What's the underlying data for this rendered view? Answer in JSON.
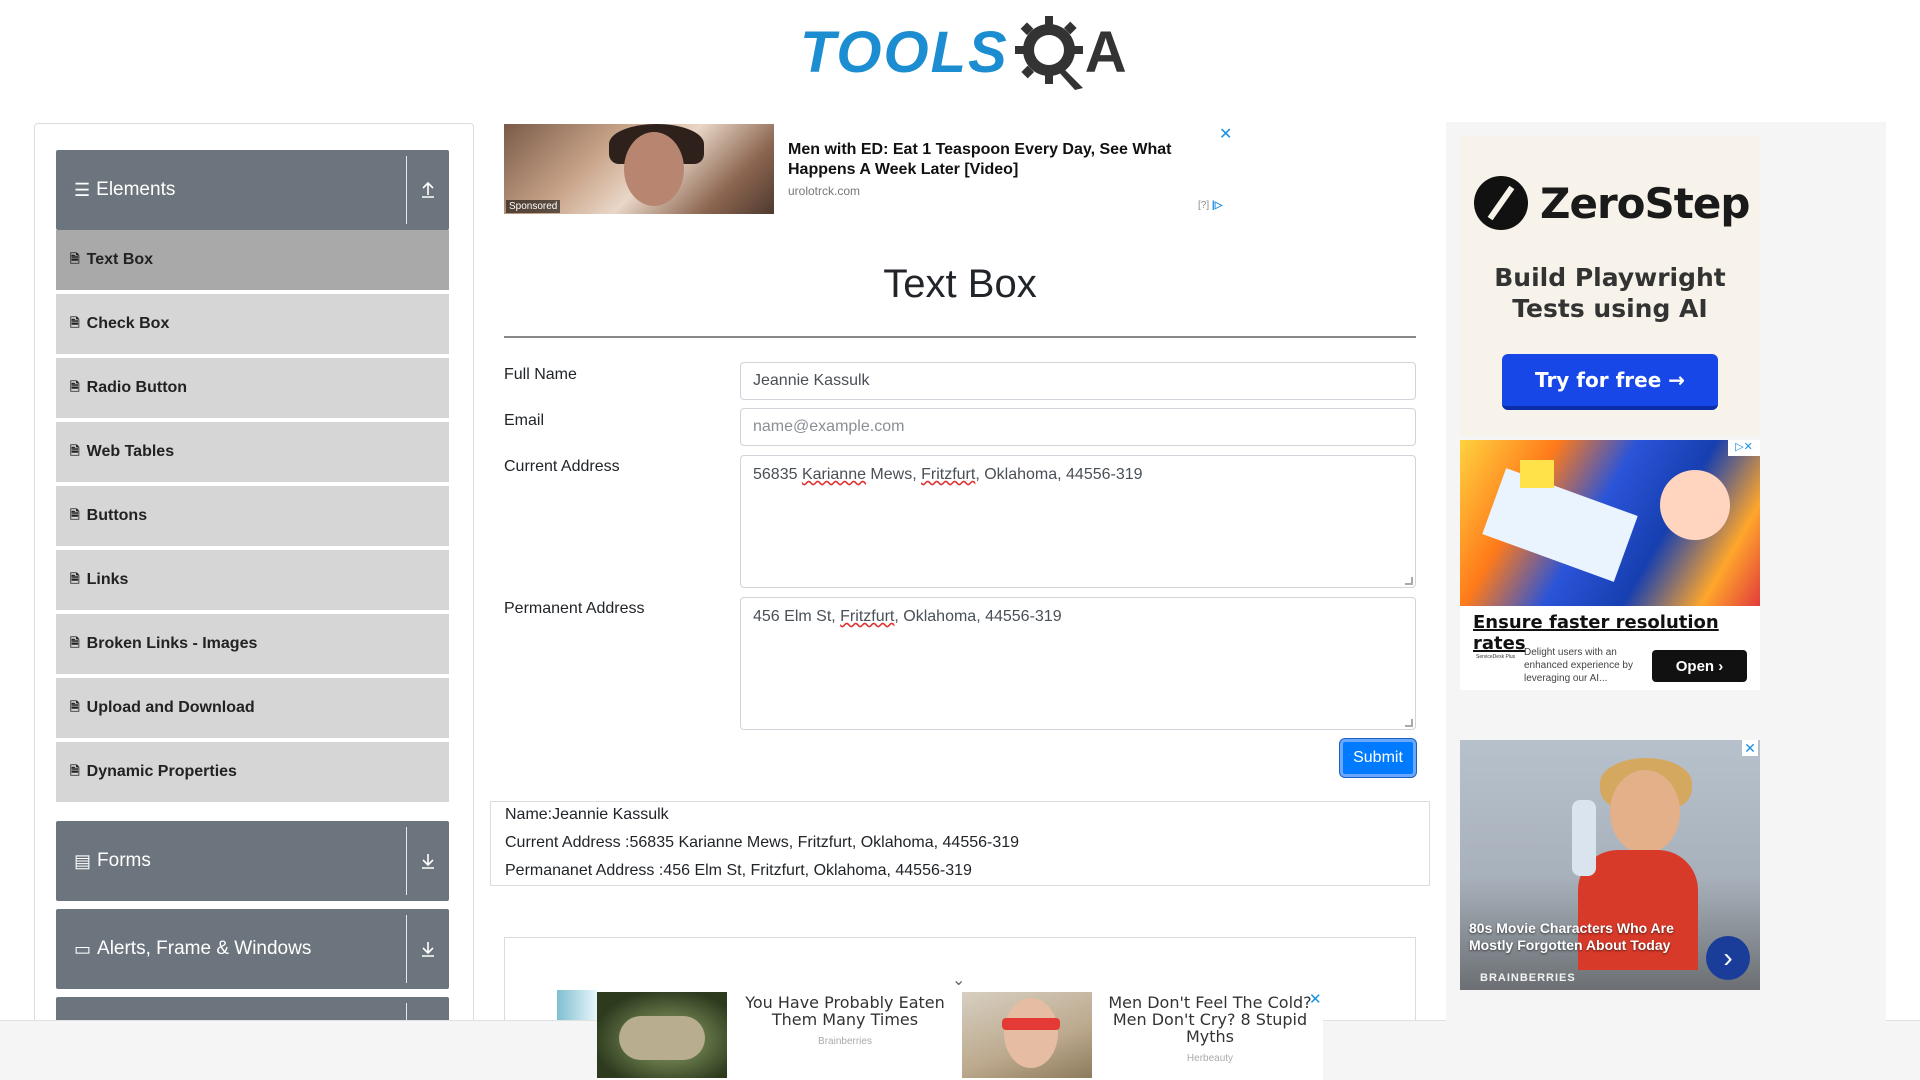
{
  "header": {
    "logo_text_left": "TOOLS",
    "logo_text_right": "A",
    "logo_icon": "gear-q-icon",
    "brand_color": "#1b8dd0"
  },
  "sidebar": {
    "groups": [
      {
        "label": "Elements",
        "icon": "hamburger-icon",
        "expanded": true,
        "arrow": "upload-arrow-icon"
      },
      {
        "label": "Forms",
        "icon": "document-icon",
        "expanded": false,
        "arrow": "download-arrow-icon"
      },
      {
        "label": "Alerts, Frame & Windows",
        "icon": "window-icon",
        "expanded": false,
        "arrow": "download-arrow-icon"
      }
    ],
    "items": [
      {
        "label": "Text Box",
        "active": true
      },
      {
        "label": "Check Box",
        "active": false
      },
      {
        "label": "Radio Button",
        "active": false
      },
      {
        "label": "Web Tables",
        "active": false
      },
      {
        "label": "Buttons",
        "active": false
      },
      {
        "label": "Links",
        "active": false
      },
      {
        "label": "Broken Links - Images",
        "active": false
      },
      {
        "label": "Upload and Download",
        "active": false
      },
      {
        "label": "Dynamic Properties",
        "active": false
      }
    ]
  },
  "top_ad": {
    "title": "Men with ED: Eat 1 Teaspoon Every Day, See What Happens A Week Later [Video]",
    "source": "urolotrck.com",
    "sponsored": "Sponsored",
    "info": "[?]",
    "close": "✕"
  },
  "main": {
    "title": "Text Box",
    "form": {
      "full_name_label": "Full Name",
      "full_name_value": "Jeannie Kassulk",
      "email_label": "Email",
      "email_placeholder": "name@example.com",
      "current_address_label": "Current Address",
      "current_address_value": {
        "p1": "56835 ",
        "w1": "Karianne",
        "p2": " Mews, ",
        "w2": "Fritzfurt",
        "p3": ", Oklahoma, 44556-319"
      },
      "permanent_address_label": "Permanent Address",
      "permanent_address_value": {
        "p1": "456 Elm St, ",
        "w1": "Fritzfurt",
        "p2": ", Oklahoma, 44556-319"
      },
      "submit_label": "Submit"
    },
    "output": {
      "name": "Name:Jeannie Kassulk",
      "current_address": "Current Address :56835 Karianne Mews, Fritzfurt, Oklahoma, 44556-319",
      "permanent_address": "Permananet Address :456 Elm St, Fritzfurt, Oklahoma, 44556-319"
    }
  },
  "bottom_ad": {
    "items": [
      {
        "title": "You Have Probably Eaten Them Many Times",
        "source": "Brainberries"
      },
      {
        "title": "Men Don't Feel The Cold? Men Don't Cry? 8 Stupid Myths",
        "source": "Herbeauty"
      }
    ],
    "close": "✕",
    "chevron": "⌄"
  },
  "right_ads": {
    "zerostep": {
      "brand": "ZeroStep",
      "subtitle": "Build Playwright Tests using AI",
      "button": "Try for free →"
    },
    "servicedesk": {
      "title": "Ensure faster resolution rates",
      "logo": "ServiceDesk Plus",
      "description": "Delight users with an enhanced experience by leveraging our AI...",
      "button": "Open ›",
      "adchoices": "▷✕"
    },
    "brainberries": {
      "title": "80s Movie Characters Who Are Mostly Forgotten About Today",
      "brand": "BRAINBERRIES",
      "close": "✕",
      "arrow": "›"
    }
  }
}
